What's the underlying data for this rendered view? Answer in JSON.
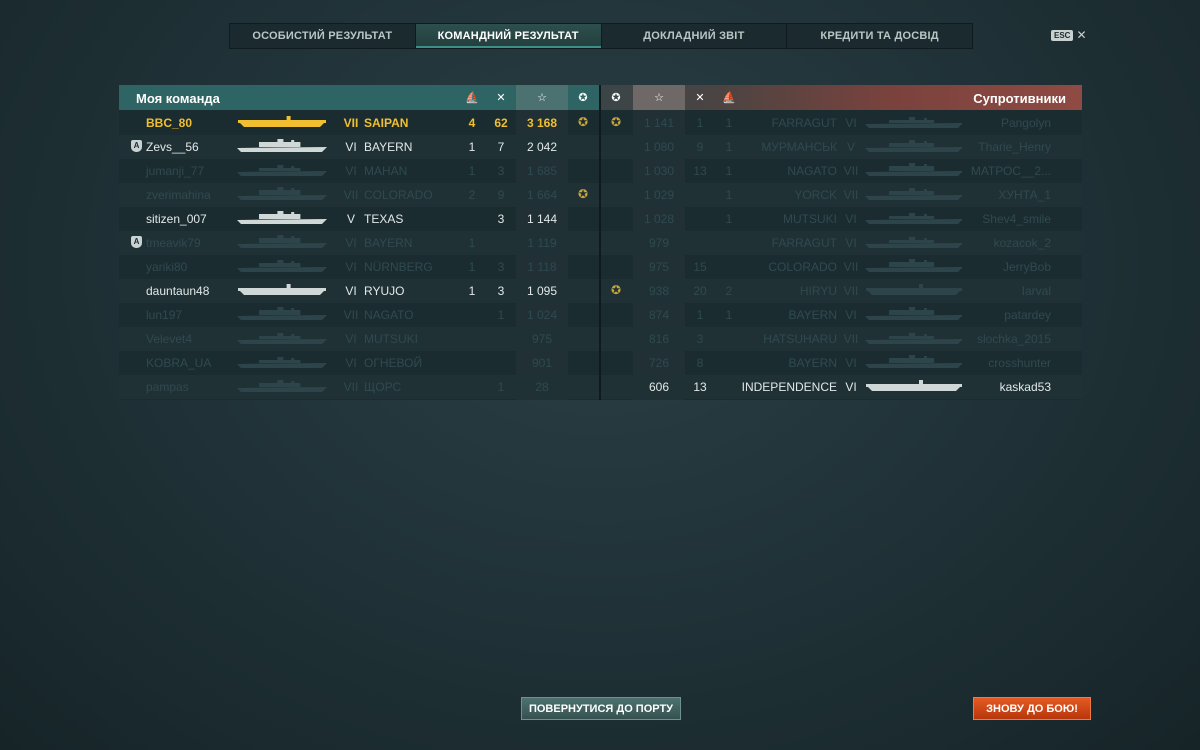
{
  "tabs": [
    "ОСОБИСТИЙ РЕЗУЛЬТАТ",
    "КОМАНДНИЙ РЕЗУЛЬТАТ",
    "ДОКЛАДНИЙ ЗВІТ",
    "КРЕДИТИ ТА ДОСВІД"
  ],
  "active_tab": 1,
  "esc_label": "ESC",
  "close_glyph": "✕",
  "my_team": {
    "title": "Моя команда",
    "header_icons": [
      "ships-destroyed-icon",
      "frags-icon",
      "experience-star-icon",
      "medal-icon"
    ],
    "header_glyphs": [
      "⛵",
      "✕",
      "☆",
      "✪"
    ],
    "rows": [
      {
        "player": "BBC_80",
        "tier": "VII",
        "ship": "SAIPAN",
        "col1": "4",
        "col2": "62",
        "exp": "3 168",
        "medal": true,
        "state": "me",
        "badge": false,
        "ship_type": "carrier"
      },
      {
        "player": "Zevs__56",
        "tier": "VI",
        "ship": "BAYERN",
        "col1": "1",
        "col2": "7",
        "exp": "2 042",
        "medal": false,
        "state": "alive",
        "badge": true,
        "ship_type": "battleship"
      },
      {
        "player": "jumanji_77",
        "tier": "VI",
        "ship": "MAHAN",
        "col1": "1",
        "col2": "3",
        "exp": "1 685",
        "medal": false,
        "state": "dead",
        "badge": false,
        "ship_type": "destroyer"
      },
      {
        "player": "zverimahina",
        "tier": "VII",
        "ship": "COLORADO",
        "col1": "2",
        "col2": "9",
        "exp": "1 664",
        "medal": true,
        "state": "dead",
        "badge": false,
        "ship_type": "battleship"
      },
      {
        "player": "sitizen_007",
        "tier": "V",
        "ship": "TEXAS",
        "col1": "",
        "col2": "3",
        "exp": "1 144",
        "medal": false,
        "state": "alive",
        "badge": false,
        "ship_type": "battleship"
      },
      {
        "player": "tmeavik79",
        "tier": "VI",
        "ship": "BAYERN",
        "col1": "1",
        "col2": "",
        "exp": "1 119",
        "medal": false,
        "state": "dead",
        "badge": true,
        "ship_type": "battleship"
      },
      {
        "player": "yariki80",
        "tier": "VI",
        "ship": "NÜRNBERG",
        "col1": "1",
        "col2": "3",
        "exp": "1 118",
        "medal": false,
        "state": "dead",
        "badge": false,
        "ship_type": "cruiser"
      },
      {
        "player": "dauntaun48",
        "tier": "VI",
        "ship": "RYUJO",
        "col1": "1",
        "col2": "3",
        "exp": "1 095",
        "medal": false,
        "state": "alive",
        "badge": false,
        "ship_type": "carrier"
      },
      {
        "player": "lun197",
        "tier": "VII",
        "ship": "NAGATO",
        "col1": "",
        "col2": "1",
        "exp": "1 024",
        "medal": false,
        "state": "dead",
        "badge": false,
        "ship_type": "battleship"
      },
      {
        "player": "Velevet4",
        "tier": "VI",
        "ship": "MUTSUKI",
        "col1": "",
        "col2": "",
        "exp": "975",
        "medal": false,
        "state": "dead",
        "badge": false,
        "ship_type": "destroyer"
      },
      {
        "player": "KOBRA_UA",
        "tier": "VI",
        "ship": "ОГНЕВОЙ",
        "col1": "",
        "col2": "",
        "exp": "901",
        "medal": false,
        "state": "dead",
        "badge": false,
        "ship_type": "destroyer"
      },
      {
        "player": "pampas",
        "tier": "VII",
        "ship": "ЩОРС",
        "col1": "",
        "col2": "1",
        "exp": "28",
        "medal": false,
        "state": "dead",
        "badge": false,
        "ship_type": "cruiser"
      }
    ]
  },
  "enemy_team": {
    "title": "Супротивники",
    "header_glyphs": [
      "✪",
      "☆",
      "✕",
      "⛵"
    ],
    "rows": [
      {
        "player": "Pangolyn",
        "tier": "VI",
        "ship": "FARRAGUT",
        "col1": "1",
        "col2": "1",
        "exp": "1 141",
        "medal": true,
        "state": "dead",
        "ship_type": "destroyer"
      },
      {
        "player": "Tharie_Henry",
        "tier": "V",
        "ship": "МУРМАНСЬК",
        "col1": "9",
        "col2": "1",
        "exp": "1 080",
        "medal": false,
        "state": "dead",
        "ship_type": "cruiser"
      },
      {
        "player": "МАТРОС__2...",
        "tier": "VII",
        "ship": "NAGATO",
        "col1": "13",
        "col2": "1",
        "exp": "1 030",
        "medal": false,
        "state": "dead",
        "ship_type": "battleship"
      },
      {
        "player": "ХУНТА_1",
        "tier": "VII",
        "ship": "YORCK",
        "col1": "",
        "col2": "1",
        "exp": "1 029",
        "medal": false,
        "state": "dead",
        "ship_type": "cruiser"
      },
      {
        "player": "Shev4_smile",
        "tier": "VI",
        "ship": "MUTSUKI",
        "col1": "",
        "col2": "1",
        "exp": "1 028",
        "medal": false,
        "state": "dead",
        "ship_type": "destroyer"
      },
      {
        "player": "kozacok_2",
        "tier": "VI",
        "ship": "FARRAGUT",
        "col1": "",
        "col2": "",
        "exp": "979",
        "medal": false,
        "state": "dead",
        "ship_type": "destroyer"
      },
      {
        "player": "JerryBob",
        "tier": "VII",
        "ship": "COLORADO",
        "col1": "15",
        "col2": "",
        "exp": "975",
        "medal": false,
        "state": "dead",
        "ship_type": "battleship"
      },
      {
        "player": "Iarval",
        "tier": "VII",
        "ship": "HIRYU",
        "col1": "20",
        "col2": "2",
        "exp": "938",
        "medal": true,
        "state": "dead",
        "ship_type": "carrier"
      },
      {
        "player": "patardey",
        "tier": "VI",
        "ship": "BAYERN",
        "col1": "1",
        "col2": "1",
        "exp": "874",
        "medal": false,
        "state": "dead",
        "ship_type": "battleship"
      },
      {
        "player": "slochka_2015",
        "tier": "VII",
        "ship": "HATSUHARU",
        "col1": "3",
        "col2": "",
        "exp": "816",
        "medal": false,
        "state": "dead",
        "ship_type": "destroyer"
      },
      {
        "player": "crosshunter",
        "tier": "VI",
        "ship": "BAYERN",
        "col1": "8",
        "col2": "",
        "exp": "726",
        "medal": false,
        "state": "dead",
        "ship_type": "battleship"
      },
      {
        "player": "kaskad53",
        "tier": "VI",
        "ship": "INDEPENDENCE",
        "col1": "13",
        "col2": "",
        "exp": "606",
        "medal": false,
        "state": "alive",
        "ship_type": "carrier"
      }
    ]
  },
  "buttons": {
    "return_to_port": "ПОВЕРНУТИСЯ ДО ПОРТУ",
    "battle_again": "ЗНОВУ ДО БОЮ!"
  },
  "badge_glyph": "A",
  "medal_glyph": "✪",
  "colors": {
    "my_team_header": "#2e6463",
    "enemy_header": "#8f4a43",
    "self_highlight": "#f0c030",
    "battle_button": "#d9481a"
  }
}
